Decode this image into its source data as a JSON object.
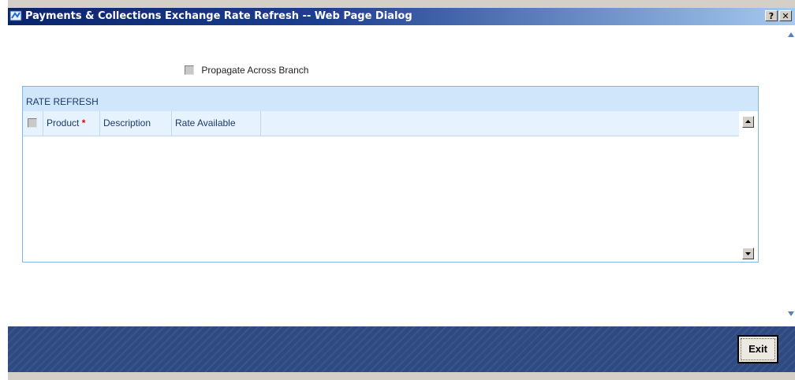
{
  "window": {
    "title": "Payments & Collections Exchange Rate Refresh -- Web Page Dialog",
    "help_label": "?",
    "close_label": "✕"
  },
  "form": {
    "propagate_label": "Propagate Across Branch"
  },
  "rate_refresh": {
    "section_title": "RATE REFRESH",
    "columns": [
      {
        "label": "Product",
        "required_mark": "*"
      },
      {
        "label": "Description"
      },
      {
        "label": "Rate Available"
      }
    ]
  },
  "footer": {
    "exit_label": "Exit"
  },
  "icons": [
    "app-icon",
    "help-icon",
    "close-icon",
    "scroll-up-icon",
    "scroll-down-icon"
  ]
}
